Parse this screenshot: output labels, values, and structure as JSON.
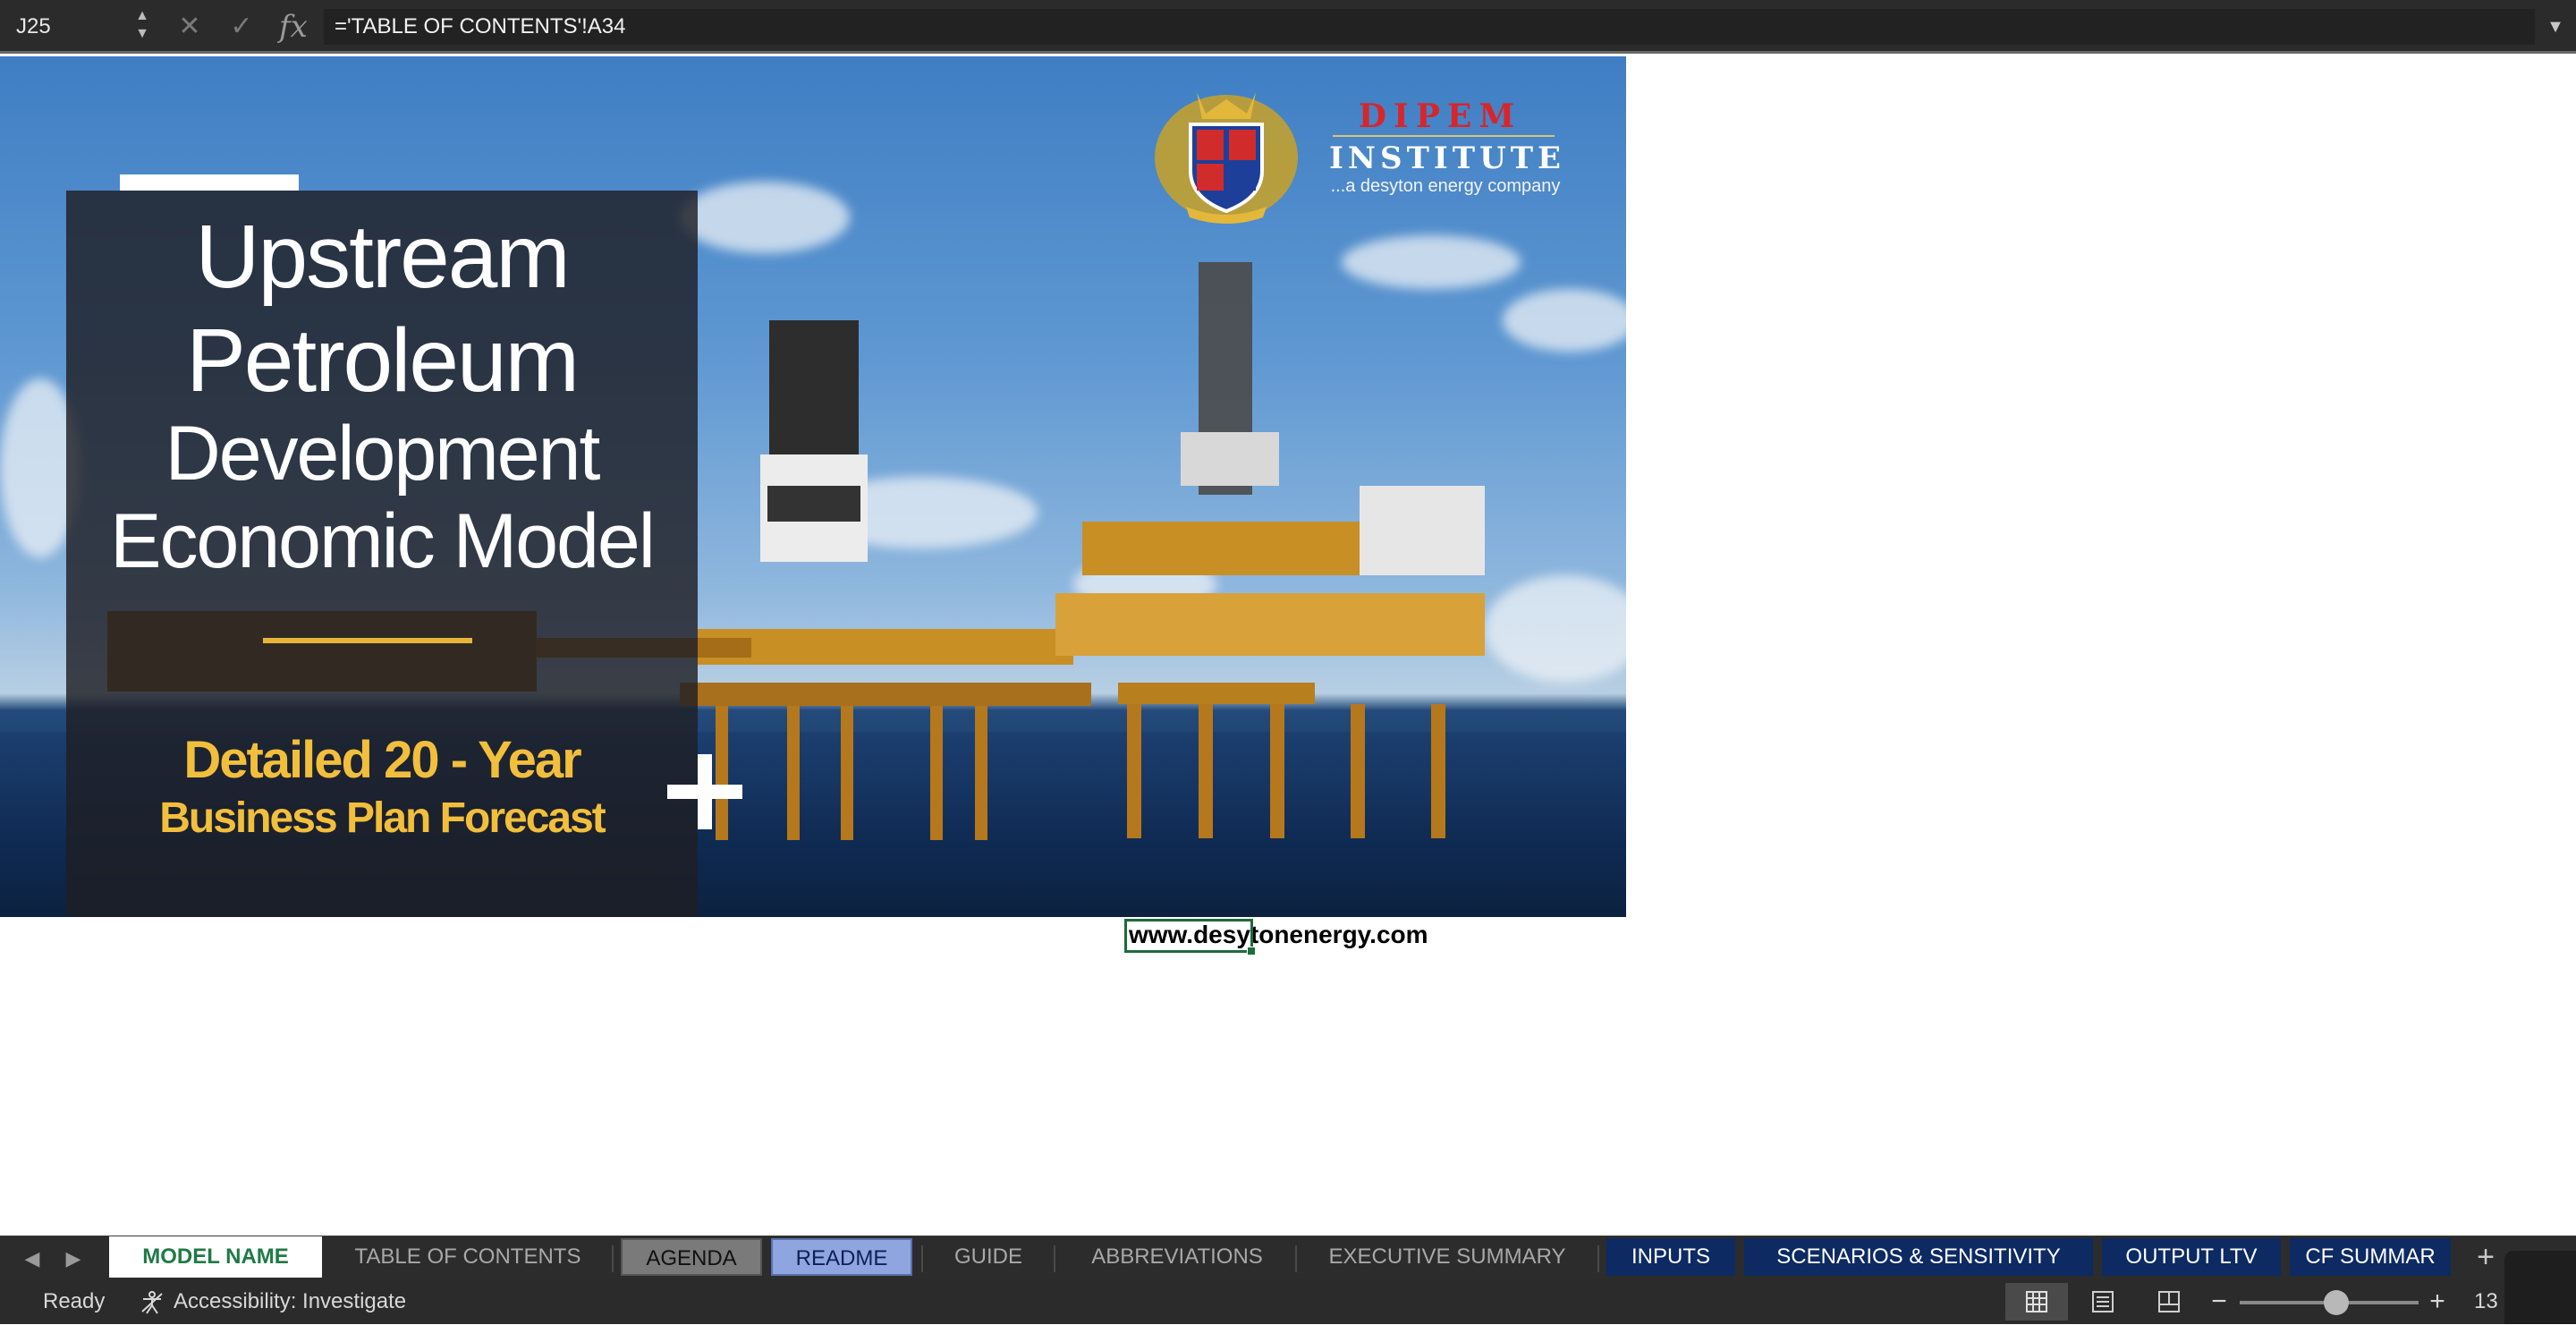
{
  "formula_bar": {
    "cell_ref": "J25",
    "fx_label": "fx",
    "formula": "='TABLE OF CONTENTS'!A34"
  },
  "banner": {
    "title_lines": [
      "Upstream",
      "Petroleum",
      "Development",
      "Economic Model"
    ],
    "subtitle_lines": [
      "Detailed 20 - Year",
      "Business Plan Forecast"
    ],
    "logo": {
      "name_line1": "DIPEM",
      "name_line2": "INSTITUTE",
      "tagline": "...a desyton energy company"
    },
    "colors": {
      "accent_gold": "#f2bf3c",
      "panel": "#1e1e24"
    }
  },
  "website_cell": {
    "text": "www.desytonenergy.com"
  },
  "sheet_tabs": {
    "items": [
      {
        "label": "MODEL NAME",
        "style": "active"
      },
      {
        "label": "TABLE OF CONTENTS",
        "style": "plain"
      },
      {
        "label": "AGENDA",
        "style": "grey"
      },
      {
        "label": "README",
        "style": "lavender"
      },
      {
        "label": "GUIDE",
        "style": "plain"
      },
      {
        "label": "ABBREVIATIONS",
        "style": "plain"
      },
      {
        "label": "EXECUTIVE SUMMARY",
        "style": "plain"
      },
      {
        "label": "INPUTS",
        "style": "navy"
      },
      {
        "label": "SCENARIOS & SENSITIVITY",
        "style": "navy"
      },
      {
        "label": "OUTPUT LTV",
        "style": "navy"
      },
      {
        "label": "CF SUMMAR",
        "style": "navy"
      }
    ],
    "colors": {
      "active_text": "#1f7a45",
      "navy": "#0d2a63",
      "lavender": "#8ea5e0"
    }
  },
  "status_bar": {
    "ready": "Ready",
    "accessibility": "Accessibility: Investigate",
    "zoom_level": "13"
  }
}
